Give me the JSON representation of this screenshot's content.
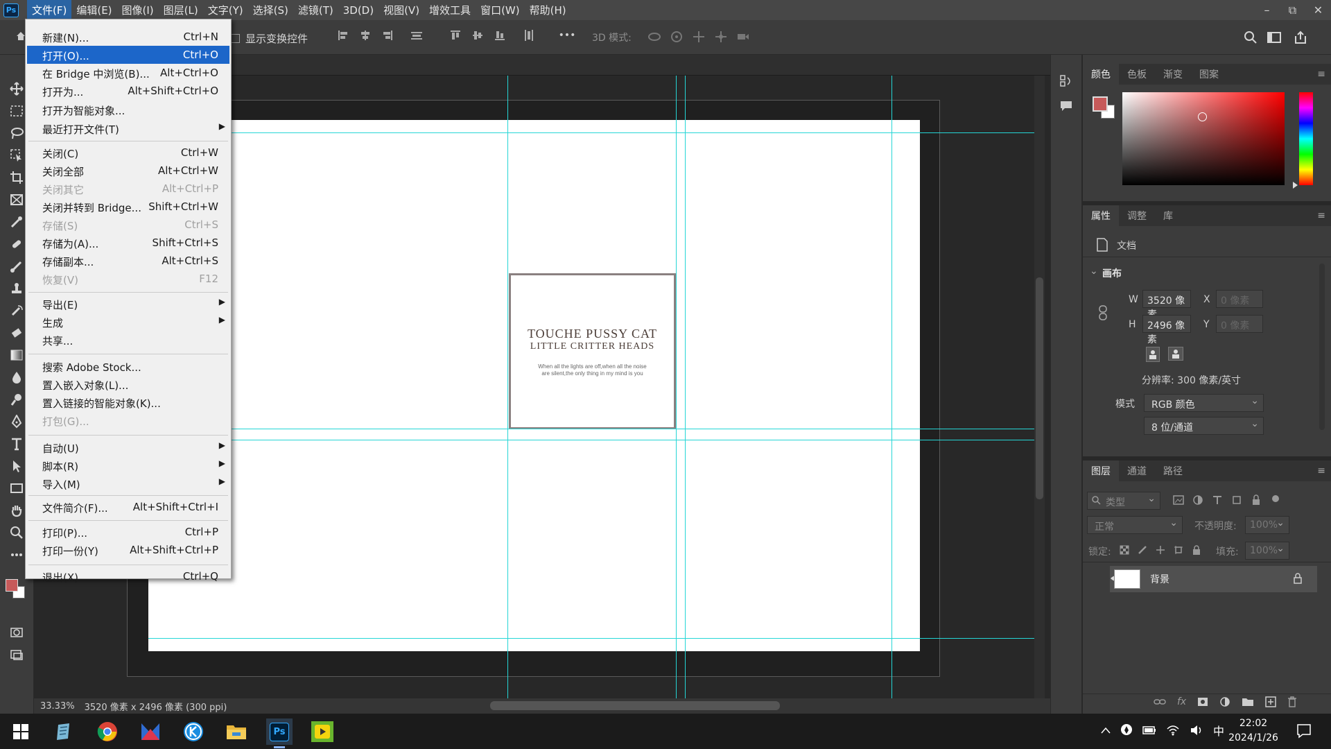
{
  "menubar": {
    "app_logo": "Ps",
    "items": [
      "文件(F)",
      "编辑(E)",
      "图像(I)",
      "图层(L)",
      "文字(Y)",
      "选择(S)",
      "滤镜(T)",
      "3D(D)",
      "视图(V)",
      "增效工具",
      "窗口(W)",
      "帮助(H)"
    ]
  },
  "window_controls": {
    "minimize": "–",
    "restore": "⧉",
    "close": "✕"
  },
  "options_bar": {
    "show_transform_label": "显示变换控件",
    "mode_3d_label": "3D 模式:",
    "more": "•••"
  },
  "file_menu": [
    {
      "label": "新建(N)...",
      "shortcut": "Ctrl+N",
      "state": "normal"
    },
    {
      "label": "打开(O)...",
      "shortcut": "Ctrl+O",
      "state": "highlighted"
    },
    {
      "label": "在 Bridge 中浏览(B)...",
      "shortcut": "Alt+Ctrl+O",
      "state": "normal"
    },
    {
      "label": "打开为...",
      "shortcut": "Alt+Shift+Ctrl+O",
      "state": "normal"
    },
    {
      "label": "打开为智能对象...",
      "shortcut": "",
      "state": "normal"
    },
    {
      "label": "最近打开文件(T)",
      "shortcut": "",
      "state": "submenu"
    },
    {
      "label": "关闭(C)",
      "shortcut": "Ctrl+W",
      "state": "normal"
    },
    {
      "label": "关闭全部",
      "shortcut": "Alt+Ctrl+W",
      "state": "normal"
    },
    {
      "label": "关闭其它",
      "shortcut": "Alt+Ctrl+P",
      "state": "disabled"
    },
    {
      "label": "关闭并转到 Bridge...",
      "shortcut": "Shift+Ctrl+W",
      "state": "normal"
    },
    {
      "label": "存储(S)",
      "shortcut": "Ctrl+S",
      "state": "disabled"
    },
    {
      "label": "存储为(A)...",
      "shortcut": "Shift+Ctrl+S",
      "state": "normal"
    },
    {
      "label": "存储副本...",
      "shortcut": "Alt+Ctrl+S",
      "state": "normal"
    },
    {
      "label": "恢复(V)",
      "shortcut": "F12",
      "state": "disabled"
    },
    {
      "label": "导出(E)",
      "shortcut": "",
      "state": "submenu"
    },
    {
      "label": "生成",
      "shortcut": "",
      "state": "submenu"
    },
    {
      "label": "共享...",
      "shortcut": "",
      "state": "normal"
    },
    {
      "label": "搜索 Adobe Stock...",
      "shortcut": "",
      "state": "normal"
    },
    {
      "label": "置入嵌入对象(L)...",
      "shortcut": "",
      "state": "normal"
    },
    {
      "label": "置入链接的智能对象(K)...",
      "shortcut": "",
      "state": "normal"
    },
    {
      "label": "打包(G)...",
      "shortcut": "",
      "state": "disabled"
    },
    {
      "label": "自动(U)",
      "shortcut": "",
      "state": "submenu"
    },
    {
      "label": "脚本(R)",
      "shortcut": "",
      "state": "submenu"
    },
    {
      "label": "导入(M)",
      "shortcut": "",
      "state": "submenu"
    },
    {
      "label": "文件简介(F)...",
      "shortcut": "Alt+Shift+Ctrl+I",
      "state": "normal"
    },
    {
      "label": "打印(P)...",
      "shortcut": "Ctrl+P",
      "state": "normal"
    },
    {
      "label": "打印一份(Y)",
      "shortcut": "Alt+Shift+Ctrl+P",
      "state": "normal"
    },
    {
      "label": "退出(X)",
      "shortcut": "Ctrl+Q",
      "state": "normal"
    }
  ],
  "card": {
    "title": "TOUCHE PUSSY CAT",
    "subtitle": "LITTLE CRITTER HEADS",
    "body": "When all the lights are off,when all the noise are silent,the only thing in my mind is you"
  },
  "status": {
    "zoom": "33.33%",
    "doc_info": "3520 像素 x 2496 像素 (300 ppi)"
  },
  "color_panel": {
    "tabs": [
      "颜色",
      "色板",
      "渐变",
      "图案"
    ],
    "fg_color": "#c75a5a",
    "bg_color": "#ffffff"
  },
  "properties_panel": {
    "tabs": [
      "属性",
      "调整",
      "库"
    ],
    "doc_label": "文档",
    "section": "画布",
    "w_label": "W",
    "w_value": "3520 像素",
    "h_label": "H",
    "h_value": "2496 像素",
    "x_label": "X",
    "x_placeholder": "0 像素",
    "y_label": "Y",
    "y_placeholder": "0 像素",
    "resolution": "分辨率: 300 像素/英寸",
    "mode_label": "模式",
    "mode_value": "RGB 颜色",
    "depth_value": "8 位/通道"
  },
  "layers_panel": {
    "tabs": [
      "图层",
      "通道",
      "路径"
    ],
    "filter_placeholder": "类型",
    "blend_mode": "正常",
    "opacity_label": "不透明度:",
    "opacity_value": "100%",
    "lock_label": "锁定:",
    "fill_label": "填充:",
    "fill_value": "100%",
    "layers": [
      {
        "name": "背景",
        "visible": true,
        "locked": true
      }
    ]
  },
  "taskbar": {
    "ime": "中",
    "time": "22:02",
    "date": "2024/1/26"
  }
}
